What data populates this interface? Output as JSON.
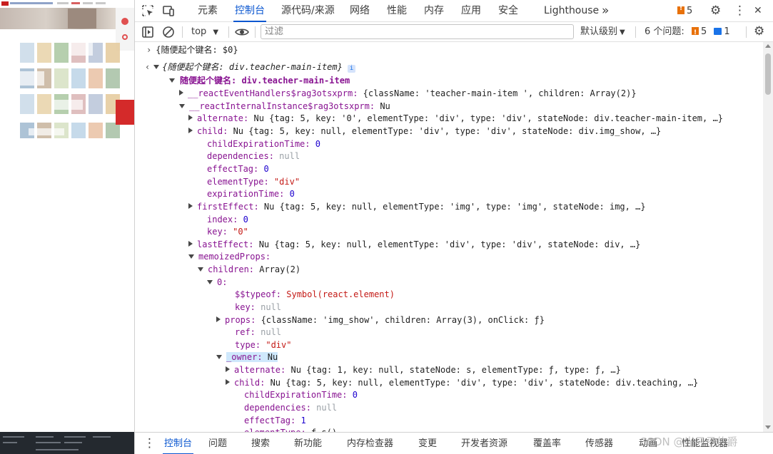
{
  "devtools": {
    "tabs": [
      "元素",
      "控制台",
      "源代码/来源",
      "网络",
      "性能",
      "内存",
      "应用",
      "安全",
      "Lighthouse"
    ],
    "active_tab": "控制台",
    "more_tabs_glyph": "»",
    "issues_badge_count": "5",
    "settings_glyph": "⚙",
    "menu_glyph": "⋮",
    "close_glyph": "✕"
  },
  "toolbar": {
    "context": "top",
    "filter_placeholder": "过滤",
    "levels": "默认级别",
    "issues_label": "6 个问题:",
    "warn_count": "5",
    "info_count": "1"
  },
  "console": {
    "lines": [
      "{随便起个键名: $0}",
      "{随便起个键名: div.teacher-main-item}",
      "随便起个键名: div.teacher-main-item",
      "__reactEventHandlers$rag3otsxprm: {className: 'teacher-main-item ', children: Array(2)}",
      "__reactInternalInstance$rag3otsxprm: Nu",
      "alternate: Nu {tag: 5, key: '0', elementType: 'div', type: 'div', stateNode: div.teacher-main-item, …}",
      "child: Nu {tag: 5, key: null, elementType: 'div', type: 'div', stateNode: div.img_show, …}",
      "childExpirationTime: 0",
      "dependencies: null",
      "effectTag: 0",
      "elementType: \"div\"",
      "expirationTime: 0",
      "firstEffect: Nu {tag: 5, key: null, elementType: 'img', type: 'img', stateNode: img, …}",
      "index: 0",
      "key: \"0\"",
      "lastEffect: Nu {tag: 5, key: null, elementType: 'div', type: 'div', stateNode: div, …}",
      "memoizedProps:",
      "children: Array(2)",
      "0:",
      "$$typeof: Symbol(react.element)",
      "key: null",
      "props: {className: 'img_show', children: Array(3), onClick: ƒ}",
      "ref: null",
      "type: \"div\"",
      "_owner: Nu",
      "alternate: Nu {tag: 1, key: null, stateNode: s, elementType: ƒ, type: ƒ, …}",
      "child: Nu {tag: 5, key: null, elementType: 'div', type: 'div', stateNode: div.teaching, …}",
      "childExpirationTime: 0",
      "dependencies: null",
      "effectTag: 1",
      "elementType: ƒ s()"
    ]
  },
  "drawer": {
    "tabs": [
      "控制台",
      "问题",
      "搜索",
      "新功能",
      "内存检查器",
      "变更",
      "开发者资源",
      "覆盖率",
      "传感器",
      "动画",
      "性能监视器"
    ],
    "active_tab": "控制台"
  },
  "watermark": "CSDN @光只子伯爵",
  "colors": {
    "accent": "#0b57d0",
    "key": "#881391",
    "string": "#c41a16",
    "number": "#1c00cf",
    "null": "#9aa0a6"
  }
}
